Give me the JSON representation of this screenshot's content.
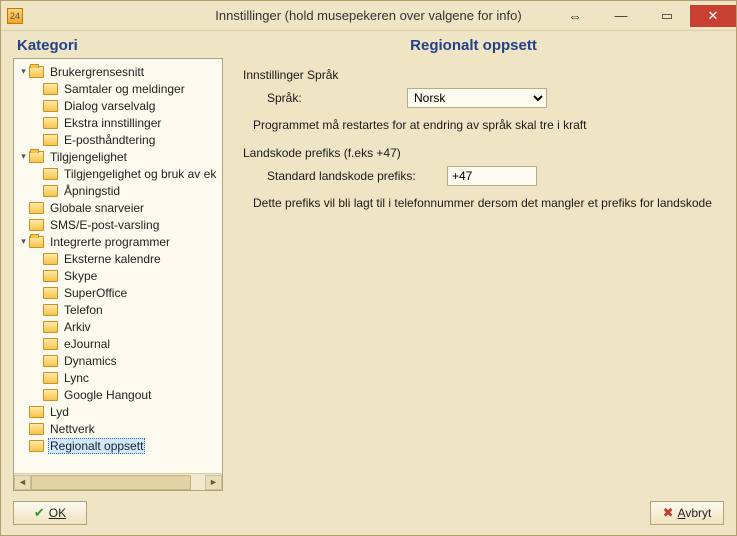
{
  "window": {
    "title": "Innstillinger (hold musepekeren over valgene for info)",
    "icon_text": "24"
  },
  "headers": {
    "left": "Kategori",
    "right": "Regionalt oppsett"
  },
  "tree": {
    "items": [
      {
        "level": 0,
        "expand": "▾",
        "open": true,
        "label": "Brukergrensesnitt"
      },
      {
        "level": 1,
        "expand": "",
        "open": false,
        "label": "Samtaler og meldinger"
      },
      {
        "level": 1,
        "expand": "",
        "open": false,
        "label": "Dialog varselvalg"
      },
      {
        "level": 1,
        "expand": "",
        "open": false,
        "label": "Ekstra innstillinger"
      },
      {
        "level": 1,
        "expand": "",
        "open": false,
        "label": "E-posthåndtering"
      },
      {
        "level": 0,
        "expand": "▾",
        "open": true,
        "label": "Tilgjengelighet"
      },
      {
        "level": 1,
        "expand": "",
        "open": false,
        "label": "Tilgjengelighet og bruk av ek"
      },
      {
        "level": 1,
        "expand": "",
        "open": false,
        "label": "Åpningstid"
      },
      {
        "level": 0,
        "expand": "",
        "open": false,
        "label": "Globale snarveier",
        "notwisty": true
      },
      {
        "level": 0,
        "expand": "",
        "open": false,
        "label": "SMS/E-post-varsling",
        "notwisty": true
      },
      {
        "level": 0,
        "expand": "▾",
        "open": true,
        "label": "Integrerte programmer"
      },
      {
        "level": 1,
        "expand": "",
        "open": false,
        "label": "Eksterne kalendre"
      },
      {
        "level": 1,
        "expand": "",
        "open": false,
        "label": "Skype"
      },
      {
        "level": 1,
        "expand": "",
        "open": false,
        "label": "SuperOffice"
      },
      {
        "level": 1,
        "expand": "",
        "open": false,
        "label": "Telefon"
      },
      {
        "level": 1,
        "expand": "",
        "open": false,
        "label": "Arkiv"
      },
      {
        "level": 1,
        "expand": "",
        "open": false,
        "label": "eJournal"
      },
      {
        "level": 1,
        "expand": "",
        "open": false,
        "label": "Dynamics"
      },
      {
        "level": 1,
        "expand": "",
        "open": false,
        "label": "Lync"
      },
      {
        "level": 1,
        "expand": "",
        "open": false,
        "label": "Google Hangout"
      },
      {
        "level": 0,
        "expand": "",
        "open": false,
        "label": "Lyd",
        "notwisty": true
      },
      {
        "level": 0,
        "expand": "",
        "open": false,
        "label": "Nettverk",
        "notwisty": true
      },
      {
        "level": 0,
        "expand": "",
        "open": false,
        "label": "Regionalt oppsett",
        "notwisty": true,
        "selected": true
      }
    ]
  },
  "panel": {
    "lang_section": "Innstillinger Språk",
    "lang_label": "Språk:",
    "lang_value": "Norsk",
    "lang_hint": "Programmet må restartes for at endring av språk skal tre i kraft",
    "prefix_section": "Landskode prefiks (f.eks +47)",
    "prefix_label": "Standard landskode prefiks:",
    "prefix_value": "+47",
    "prefix_hint": "Dette prefiks vil bli lagt til i telefonnummer dersom det mangler et prefiks for landskode"
  },
  "buttons": {
    "ok": "OK",
    "cancel": "Avbryt"
  }
}
